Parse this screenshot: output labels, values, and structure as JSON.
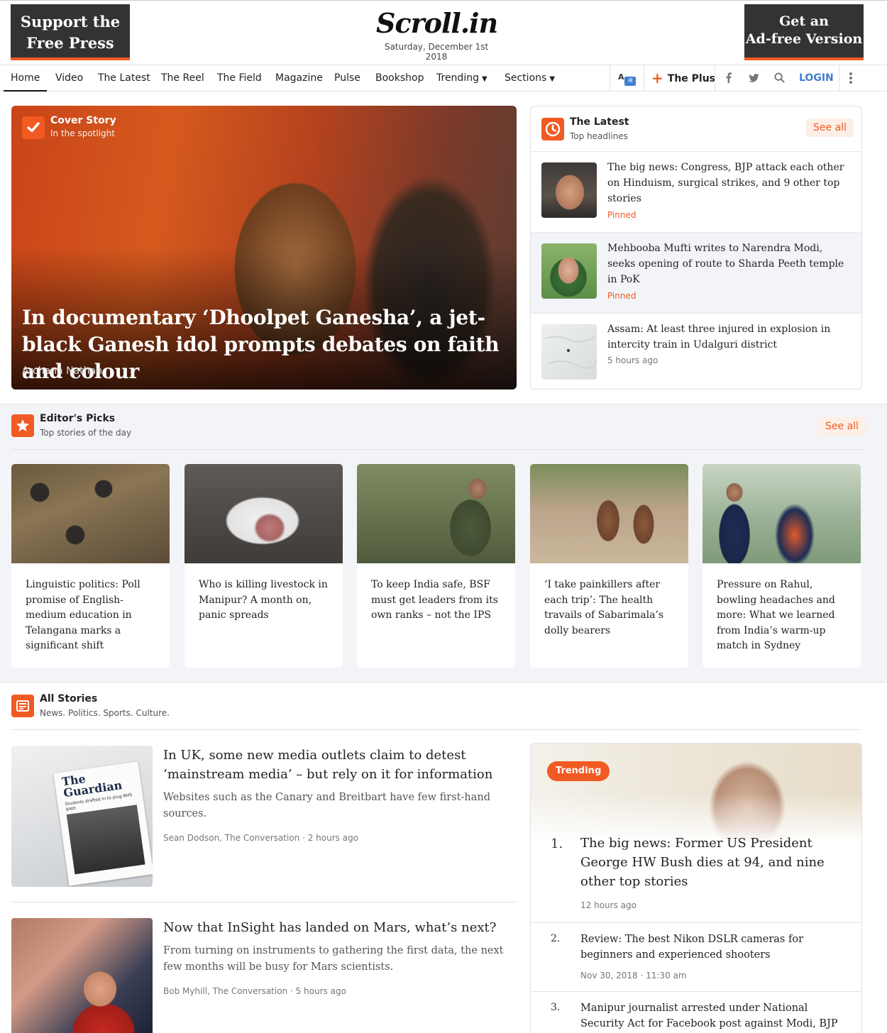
{
  "header": {
    "support_line1": "Support the",
    "support_line2": "Free Press",
    "logo": "Scroll.in",
    "date": "Saturday, December 1st 2018",
    "adfree_line1": "Get an",
    "adfree_line2": "Ad-free Version"
  },
  "nav": {
    "items": [
      "Home",
      "Video",
      "The Latest",
      "The Reel",
      "The Field",
      "Magazine",
      "Pulse",
      "Bookshop",
      "Trending",
      "Sections"
    ],
    "lang_a": "A",
    "lang_hi": "अ",
    "plus_label": "The Plus",
    "login": "LOGIN",
    "icons": [
      "language-icon",
      "facebook-icon",
      "twitter-icon",
      "search-icon",
      "more-icon"
    ]
  },
  "cover": {
    "kicker": "Cover Story",
    "kicker_sub": "In the spotlight",
    "title": "In documentary ‘Dhoolpet Ganesha’, a jet-black Ganesh idol prompts debates on faith and colour",
    "author": "Archana Nathan"
  },
  "latest": {
    "title": "The Latest",
    "subtitle": "Top headlines",
    "see_all": "See all",
    "items": [
      {
        "title": "The big news: Congress, BJP attack each other on Hinduism, surgical strikes, and 9 other top stories",
        "meta": "Pinned"
      },
      {
        "title": "Mehbooba Mufti writes to Narendra Modi, seeks opening of route to Sharda Peeth temple in PoK",
        "meta": "Pinned"
      },
      {
        "title": "Assam: At least three injured in explosion in intercity train in Udalguri district",
        "meta": "5 hours ago"
      }
    ]
  },
  "editors_picks": {
    "title": "Editor's Picks",
    "subtitle": "Top stories of the day",
    "see_all": "See all",
    "cards": [
      {
        "title": "Linguistic politics: Poll promise of English-medium education in Telangana marks a significant shift"
      },
      {
        "title": "Who is killing livestock in Manipur? A month on, panic spreads"
      },
      {
        "title": "To keep India safe, BSF must get leaders from its own ranks – not the IPS"
      },
      {
        "title": "‘I take painkillers after each trip’: The health travails of Sabarimala’s dolly bearers"
      },
      {
        "title": "Pressure on Rahul, bowling headaches and more: What we learned from India’s warm-up match in Sydney"
      }
    ]
  },
  "all_stories": {
    "title": "All Stories",
    "subtitle": "News. Politics. Sports. Culture.",
    "stories": [
      {
        "title": "In UK, some new media outlets claim to detest ‘mainstream media’ – but rely on it for information",
        "desc": "Websites such as the Canary and Breitbart have few first-hand sources.",
        "meta": "Sean Dodson, The Conversation · 2 hours ago",
        "img_text_1": "The",
        "img_text_2": "Guardian",
        "img_text_3": "Students drafted in to plug NHS gaps"
      },
      {
        "title": "Now that InSight has landed on Mars, what’s next?",
        "desc": "From turning on instruments to gathering the first data, the next few months will be busy for Mars scientists.",
        "meta": "Bob Myhill, The Conversation · 5 hours ago"
      }
    ]
  },
  "trending": {
    "label": "Trending",
    "items": [
      {
        "num": "1.",
        "title": "The big news: Former US President George HW Bush dies at 94, and nine other top stories",
        "meta": "12 hours ago"
      },
      {
        "num": "2.",
        "title": "Review: The best Nikon DSLR cameras for beginners and experienced shooters",
        "meta": "Nov 30, 2018 · 11:30 am"
      },
      {
        "num": "3.",
        "title": "Manipur journalist arrested under National Security Act for Facebook post against Modi, BJP",
        "meta": ""
      }
    ]
  },
  "colors": {
    "accent": "#f15a22",
    "login": "#3f7fd1",
    "dark_promo": "#333333",
    "band": "#f3f4f8"
  }
}
